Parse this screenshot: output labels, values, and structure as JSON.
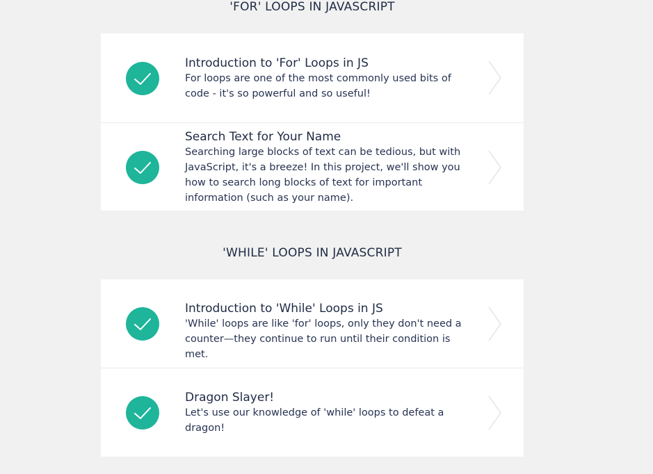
{
  "sections": [
    {
      "title": "'FOR' LOOPS IN JAVASCRIPT",
      "items": [
        {
          "title": "Introduction to 'For' Loops in JS",
          "description": "For loops are one of the most commonly used bits of code - it's so powerful and so useful!",
          "completed": true,
          "icon": "check-icon"
        },
        {
          "title": "Search Text for Your Name",
          "description": "Searching large blocks of text can be tedious, but with JavaScript, it's a breeze! In this project, we'll show you how to search long blocks of text for important information (such as your name).",
          "completed": true,
          "icon": "check-icon"
        }
      ]
    },
    {
      "title": "'WHILE' LOOPS IN JAVASCRIPT",
      "items": [
        {
          "title": "Introduction to 'While' Loops in JS",
          "description": "'While' loops are like 'for' loops, only they don't need a counter—they continue to run until their condition is met.",
          "completed": true,
          "icon": "check-icon"
        },
        {
          "title": "Dragon Slayer!",
          "description": "Let's use our knowledge of 'while' loops to defeat a dragon!",
          "completed": true,
          "icon": "check-icon"
        }
      ]
    }
  ],
  "colors": {
    "background": "#f0f1f0",
    "card": "#ffffff",
    "accent": "#1fb59a",
    "text": "#1f2a44",
    "chevron": "#e3e5e4"
  }
}
